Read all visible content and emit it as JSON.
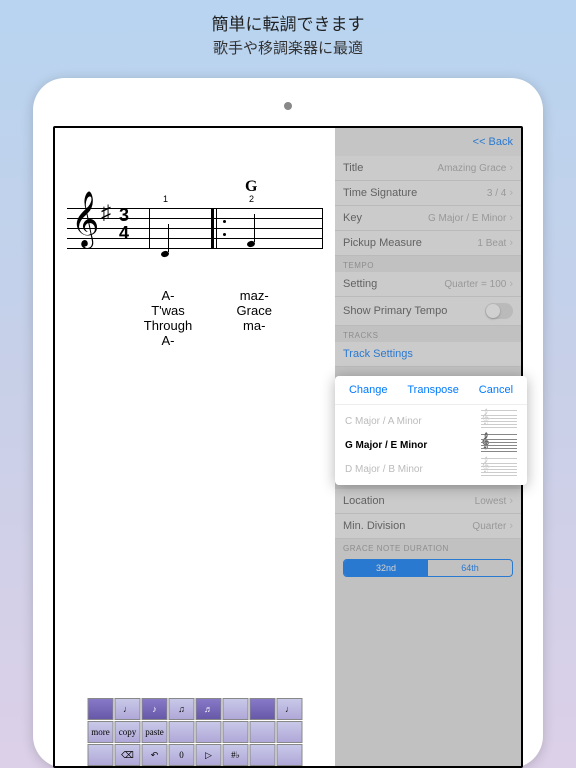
{
  "header": {
    "title": "簡単に転調できます",
    "subtitle": "歌手や移調楽器に最適"
  },
  "score": {
    "timesig_top": "3",
    "timesig_bot": "4",
    "chord": "G",
    "fingering1": "1",
    "fingering2": "2",
    "lyrics": {
      "col1": [
        "A-",
        "T'was",
        "Through",
        "A-"
      ],
      "col2": [
        "maz-",
        "Grace",
        "ma-",
        ""
      ]
    }
  },
  "palette": [
    "",
    "♩",
    "♪",
    "♫",
    "♬",
    "",
    "",
    "♩",
    "more",
    "copy",
    "paste",
    "",
    "",
    "",
    "",
    "",
    "",
    "",
    "",
    "",
    "⌫",
    "↶",
    "0",
    "▷",
    "#♭",
    "",
    ""
  ],
  "side": {
    "back": "<< Back",
    "rows": [
      {
        "label": "Title",
        "value": "Amazing Grace"
      },
      {
        "label": "Time Signature",
        "value": "3 / 4"
      },
      {
        "label": "Key",
        "value": "G Major / E Minor"
      },
      {
        "label": "Pickup Measure",
        "value": "1 Beat"
      }
    ],
    "tempo_section": "TEMPO",
    "tempo_setting": {
      "label": "Setting",
      "value": "Quarter = 100"
    },
    "show_primary": "Show Primary Tempo",
    "tracks_section": "TRACKS",
    "track_settings": "Track Settings",
    "location": {
      "label": "Location",
      "value": "Lowest"
    },
    "mindiv": {
      "label": "Min. Division",
      "value": "Quarter"
    },
    "grace_section": "GRACE NOTE DURATION",
    "seg": [
      "32nd",
      "64th"
    ]
  },
  "popover": {
    "change": "Change",
    "transpose": "Transpose",
    "cancel": "Cancel",
    "keys": [
      "C Major / A Minor",
      "G Major / E Minor",
      "D Major / B Minor"
    ]
  }
}
